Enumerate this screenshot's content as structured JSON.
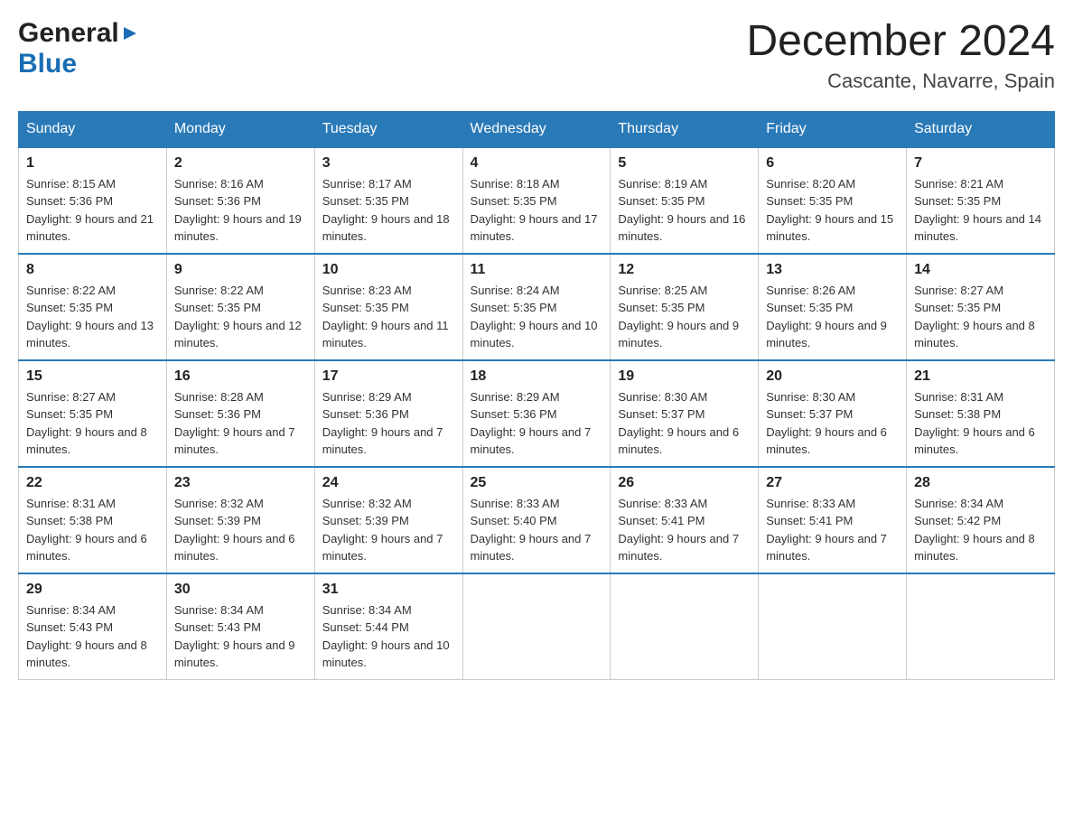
{
  "header": {
    "logo_general": "General",
    "logo_blue": "Blue",
    "month_title": "December 2024",
    "location": "Cascante, Navarre, Spain"
  },
  "days_of_week": [
    "Sunday",
    "Monday",
    "Tuesday",
    "Wednesday",
    "Thursday",
    "Friday",
    "Saturday"
  ],
  "weeks": [
    [
      {
        "day": "1",
        "sunrise": "8:15 AM",
        "sunset": "5:36 PM",
        "daylight": "9 hours and 21 minutes."
      },
      {
        "day": "2",
        "sunrise": "8:16 AM",
        "sunset": "5:36 PM",
        "daylight": "9 hours and 19 minutes."
      },
      {
        "day": "3",
        "sunrise": "8:17 AM",
        "sunset": "5:35 PM",
        "daylight": "9 hours and 18 minutes."
      },
      {
        "day": "4",
        "sunrise": "8:18 AM",
        "sunset": "5:35 PM",
        "daylight": "9 hours and 17 minutes."
      },
      {
        "day": "5",
        "sunrise": "8:19 AM",
        "sunset": "5:35 PM",
        "daylight": "9 hours and 16 minutes."
      },
      {
        "day": "6",
        "sunrise": "8:20 AM",
        "sunset": "5:35 PM",
        "daylight": "9 hours and 15 minutes."
      },
      {
        "day": "7",
        "sunrise": "8:21 AM",
        "sunset": "5:35 PM",
        "daylight": "9 hours and 14 minutes."
      }
    ],
    [
      {
        "day": "8",
        "sunrise": "8:22 AM",
        "sunset": "5:35 PM",
        "daylight": "9 hours and 13 minutes."
      },
      {
        "day": "9",
        "sunrise": "8:22 AM",
        "sunset": "5:35 PM",
        "daylight": "9 hours and 12 minutes."
      },
      {
        "day": "10",
        "sunrise": "8:23 AM",
        "sunset": "5:35 PM",
        "daylight": "9 hours and 11 minutes."
      },
      {
        "day": "11",
        "sunrise": "8:24 AM",
        "sunset": "5:35 PM",
        "daylight": "9 hours and 10 minutes."
      },
      {
        "day": "12",
        "sunrise": "8:25 AM",
        "sunset": "5:35 PM",
        "daylight": "9 hours and 9 minutes."
      },
      {
        "day": "13",
        "sunrise": "8:26 AM",
        "sunset": "5:35 PM",
        "daylight": "9 hours and 9 minutes."
      },
      {
        "day": "14",
        "sunrise": "8:27 AM",
        "sunset": "5:35 PM",
        "daylight": "9 hours and 8 minutes."
      }
    ],
    [
      {
        "day": "15",
        "sunrise": "8:27 AM",
        "sunset": "5:35 PM",
        "daylight": "9 hours and 8 minutes."
      },
      {
        "day": "16",
        "sunrise": "8:28 AM",
        "sunset": "5:36 PM",
        "daylight": "9 hours and 7 minutes."
      },
      {
        "day": "17",
        "sunrise": "8:29 AM",
        "sunset": "5:36 PM",
        "daylight": "9 hours and 7 minutes."
      },
      {
        "day": "18",
        "sunrise": "8:29 AM",
        "sunset": "5:36 PM",
        "daylight": "9 hours and 7 minutes."
      },
      {
        "day": "19",
        "sunrise": "8:30 AM",
        "sunset": "5:37 PM",
        "daylight": "9 hours and 6 minutes."
      },
      {
        "day": "20",
        "sunrise": "8:30 AM",
        "sunset": "5:37 PM",
        "daylight": "9 hours and 6 minutes."
      },
      {
        "day": "21",
        "sunrise": "8:31 AM",
        "sunset": "5:38 PM",
        "daylight": "9 hours and 6 minutes."
      }
    ],
    [
      {
        "day": "22",
        "sunrise": "8:31 AM",
        "sunset": "5:38 PM",
        "daylight": "9 hours and 6 minutes."
      },
      {
        "day": "23",
        "sunrise": "8:32 AM",
        "sunset": "5:39 PM",
        "daylight": "9 hours and 6 minutes."
      },
      {
        "day": "24",
        "sunrise": "8:32 AM",
        "sunset": "5:39 PM",
        "daylight": "9 hours and 7 minutes."
      },
      {
        "day": "25",
        "sunrise": "8:33 AM",
        "sunset": "5:40 PM",
        "daylight": "9 hours and 7 minutes."
      },
      {
        "day": "26",
        "sunrise": "8:33 AM",
        "sunset": "5:41 PM",
        "daylight": "9 hours and 7 minutes."
      },
      {
        "day": "27",
        "sunrise": "8:33 AM",
        "sunset": "5:41 PM",
        "daylight": "9 hours and 7 minutes."
      },
      {
        "day": "28",
        "sunrise": "8:34 AM",
        "sunset": "5:42 PM",
        "daylight": "9 hours and 8 minutes."
      }
    ],
    [
      {
        "day": "29",
        "sunrise": "8:34 AM",
        "sunset": "5:43 PM",
        "daylight": "9 hours and 8 minutes."
      },
      {
        "day": "30",
        "sunrise": "8:34 AM",
        "sunset": "5:43 PM",
        "daylight": "9 hours and 9 minutes."
      },
      {
        "day": "31",
        "sunrise": "8:34 AM",
        "sunset": "5:44 PM",
        "daylight": "9 hours and 10 minutes."
      },
      null,
      null,
      null,
      null
    ]
  ]
}
